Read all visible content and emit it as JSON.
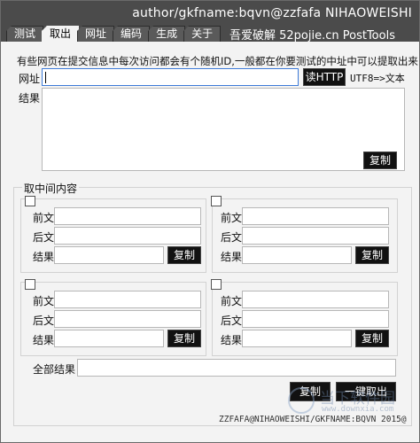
{
  "window": {
    "title": "author/gkfname:bqvn@zzfafa NIHAOWEISHI",
    "promo": "吾爱破解 52pojie.cn  PostTools"
  },
  "tabs": [
    {
      "label": "测试"
    },
    {
      "label": "取出",
      "active": true
    },
    {
      "label": "网址"
    },
    {
      "label": "编码"
    },
    {
      "label": "生成"
    },
    {
      "label": "关于"
    }
  ],
  "main": {
    "hint": "有些网页在提交信息中每次访问都会有个随机ID,一般都在你要测试的中址中可以提取出来",
    "url_label": "网址",
    "url_value": "",
    "read_http_button": "读HTTP",
    "encoding_label": "UTF8=>文本",
    "result_label": "结果",
    "result_value": "",
    "copy_button": "复制"
  },
  "extract_group": {
    "title": "取中间内容",
    "blocks": [
      {
        "checked": false,
        "prefix_label": "前文",
        "prefix_value": "",
        "suffix_label": "后文",
        "suffix_value": "",
        "result_label": "结果",
        "result_value": "",
        "copy_button": "复制"
      },
      {
        "checked": false,
        "prefix_label": "前文",
        "prefix_value": "",
        "suffix_label": "后文",
        "suffix_value": "",
        "result_label": "结果",
        "result_value": "",
        "copy_button": "复制"
      },
      {
        "checked": false,
        "prefix_label": "前文",
        "prefix_value": "",
        "suffix_label": "后文",
        "suffix_value": "",
        "result_label": "结果",
        "result_value": "",
        "copy_button": "复制"
      },
      {
        "checked": false,
        "prefix_label": "前文",
        "prefix_value": "",
        "suffix_label": "后文",
        "suffix_value": "",
        "result_label": "结果",
        "result_value": "",
        "copy_button": "复制"
      }
    ],
    "all_result_label": "全部结果",
    "all_result_value": "",
    "copy_button": "复制",
    "extract_all_button": "一键取出"
  },
  "footer": {
    "credit": "ZZFAFA@NIHAOWEISHI/GKFNAME:BQVN 2015@"
  },
  "watermark": {
    "text": "当下软件园",
    "url": "www.downxia.com"
  }
}
